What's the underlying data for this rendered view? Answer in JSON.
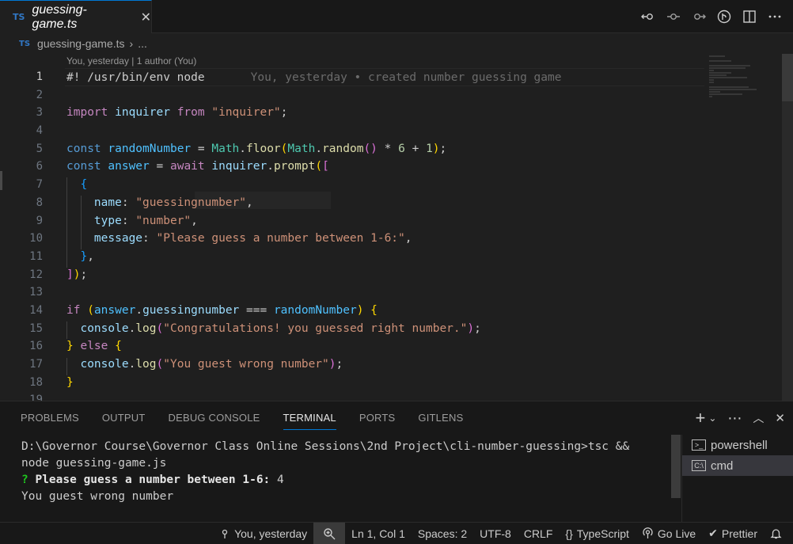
{
  "tab": {
    "badge": "TS",
    "label": "guessing-game.ts",
    "close": "✕"
  },
  "breadcrumb": {
    "badge": "TS",
    "file": "guessing-game.ts",
    "sep": "›",
    "more": "..."
  },
  "editor": {
    "lens": "You, yesterday | 1 author (You)",
    "blame": "You, yesterday • created number guessing game",
    "line_numbers": [
      "1",
      "2",
      "3",
      "4",
      "5",
      "6",
      "7",
      "8",
      "9",
      "10",
      "11",
      "12",
      "13",
      "14",
      "15",
      "16",
      "17",
      "18",
      "19"
    ],
    "ghost_hint": ""
  },
  "panel": {
    "tabs": [
      "PROBLEMS",
      "OUTPUT",
      "DEBUG CONSOLE",
      "TERMINAL",
      "PORTS",
      "GITLENS"
    ],
    "active_tab": "TERMINAL",
    "terminal_lines": [
      "D:\\Governor Course\\Governor Class Online Sessions\\2nd Project\\cli-number-guessing>tsc &&",
      "node guessing-game.js"
    ],
    "prompt_mark": "?",
    "prompt_text": "Please guess a number between 1-6:",
    "prompt_answer": " 4",
    "result_line": "You guest wrong number",
    "terminals": [
      {
        "label": "powershell",
        "icon": ">_"
      },
      {
        "label": "cmd",
        "icon": "C:\\"
      }
    ]
  },
  "statusbar": {
    "blame": "You, yesterday",
    "position": "Ln 1, Col 1",
    "spaces": "Spaces: 2",
    "encoding": "UTF-8",
    "eol": "CRLF",
    "language": "TypeScript",
    "golive": "Go Live",
    "prettier": "Prettier"
  }
}
